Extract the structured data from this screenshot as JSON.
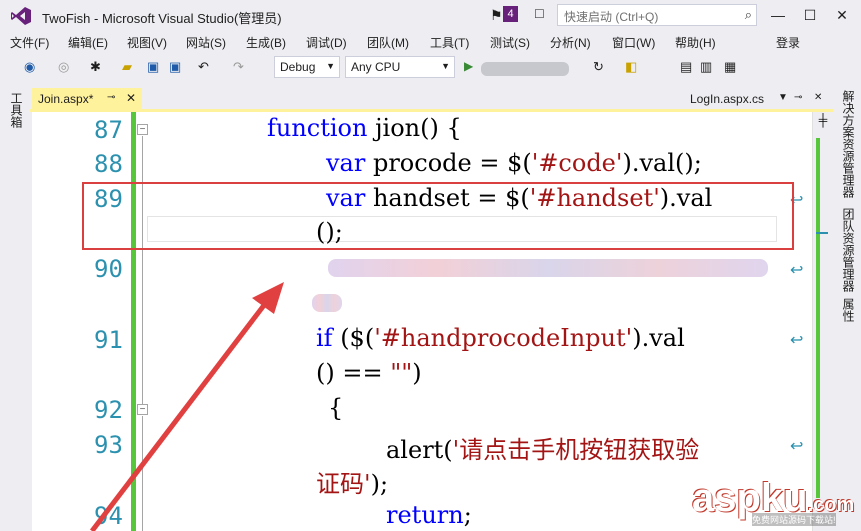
{
  "window": {
    "title": "TwoFish - Microsoft Visual Studio(管理员)",
    "notification_count": "4",
    "quick_launch_placeholder": "快速启动 (Ctrl+Q)"
  },
  "menu": {
    "items": [
      "文件(F)",
      "编辑(E)",
      "视图(V)",
      "网站(S)",
      "生成(B)",
      "调试(D)",
      "团队(M)",
      "工具(T)",
      "测试(S)",
      "分析(N)",
      "窗口(W)",
      "帮助(H)"
    ],
    "login": "登录"
  },
  "toolbar": {
    "config": "Debug",
    "platform": "Any CPU"
  },
  "left_panel": {
    "toolbox": "工具箱"
  },
  "right_panel": {
    "solution_explorer": "解决方案资源管理器",
    "team_explorer": "团队资源管理器",
    "properties": "属性"
  },
  "tabs": {
    "active": "Join.aspx*",
    "right": "LogIn.aspx.cs"
  },
  "editor": {
    "line_numbers": [
      "87",
      "88",
      "89",
      "90",
      "91",
      "92",
      "93",
      "94"
    ],
    "lines": {
      "l87_kw": "function",
      "l87_rest": " jion() {",
      "l88_kw": "var",
      "l88_rest": " procode = $(",
      "l88_str": "'#code'",
      "l88_end": ").val();",
      "l89_kw": "var",
      "l89_rest": " handset = $(",
      "l89_str": "'#handset'",
      "l89_end": ").val",
      "l89_wrap": "();",
      "l91_kw": "if",
      "l91_rest": " ($(",
      "l91_str": "'#handprocodeInput'",
      "l91_end": ").val",
      "l91_wrap_a": "() == ",
      "l91_wrap_str": "\"\"",
      "l91_wrap_b": ")",
      "l92": "{",
      "l93_a": "alert(",
      "l93_str": "'请点击手机按钮获取验",
      "l93_wrap_str": "证码'",
      "l93_wrap_b": ");",
      "l94_kw": "return",
      "l94_rest": ";"
    }
  },
  "watermark": {
    "text": "aspku",
    "suffix": ".com",
    "subtitle": "免费网站源码下载站!"
  },
  "colors": {
    "keyword": "#0000FF",
    "string": "#A31515",
    "line_number": "#2B91AF",
    "highlight_box": "#D9403F",
    "arrow": "#E0403F",
    "accent": "#68217A"
  }
}
